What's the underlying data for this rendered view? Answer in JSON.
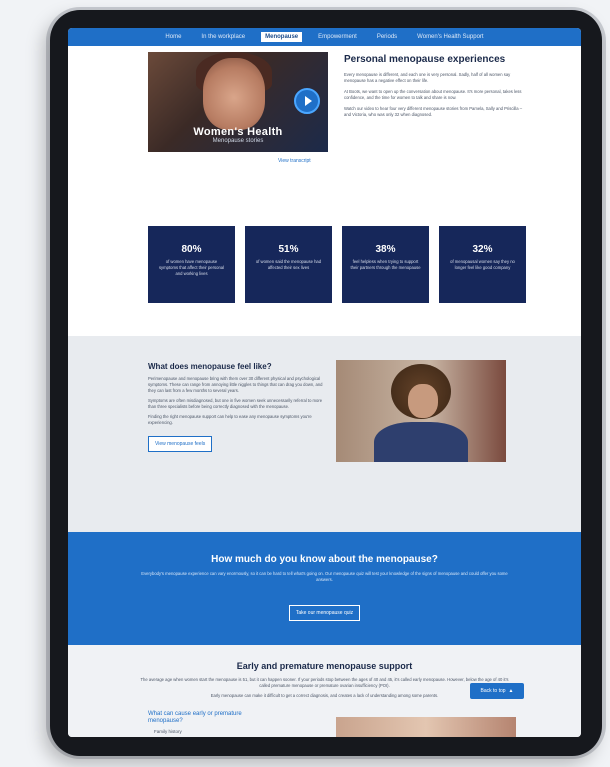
{
  "nav": {
    "items": [
      "Home",
      "In the workplace",
      "Menopause",
      "Empowerment",
      "Periods",
      "Women's Health Support"
    ],
    "active_index": 2
  },
  "story": {
    "video_title": "Women's Health",
    "video_subtitle": "Menopause stories",
    "transcript_link": "View transcript",
    "heading": "Personal menopause experiences",
    "paragraphs": [
      "Every menopause is different, and each one is very personal. Sadly, half of all women say menopause has a negative effect on their life.",
      "At Boots, we want to open up the conversation about menopause. It's more personal, takes less confidence, and the time for women to talk and share is now.",
      "Watch our video to hear four very different menopause stories from Pamela, Sally and Priscilla – and Victoria, who was only 32 when diagnosed."
    ]
  },
  "stats": [
    {
      "num": "80%",
      "desc": "of women have menopause symptoms that affect their personal and working lives"
    },
    {
      "num": "51%",
      "desc": "of women said the menopause had affected their sex lives"
    },
    {
      "num": "38%",
      "desc": "feel helpless when trying to support their partners through the menopause"
    },
    {
      "num": "32%",
      "desc": "of menopausal women say they no longer feel like good company"
    }
  ],
  "feel": {
    "heading": "What does menopause feel like?",
    "paragraphs": [
      "Perimenopause and menopause bring with them over 30 different physical and psychological symptoms. These can range from annoying little niggles to things that can drag you down, and they can last from a few months to several years.",
      "Symptoms are often misdiagnosed, but one in five women seek unnecessarily referral to more than three specialists before being correctly diagnosed with the menopause.",
      "Finding the right menopause support can help to ease any menopause symptoms you're experiencing."
    ],
    "button": "View menopause feels"
  },
  "quiz": {
    "heading": "How much do you know about the menopause?",
    "text": "Everybody's menopause experience can vary enormously, so it can be hard to tell what's going on. Our menopause quiz will test your knowledge of the signs of menopause and could offer you some answers.",
    "button": "Take our menopause quiz"
  },
  "early": {
    "heading": "Early and premature menopause support",
    "p1": "The average age when women start the menopause is 51, but it can happen sooner. If your periods stop between the ages of 40 and 45, it's called early menopause. However, below the age of 40 it's called premature menopause or premature ovarian insufficiency (POI).",
    "p2": "Early menopause can make it difficult to get a correct diagnosis, and creates a lack of understanding among some parents.",
    "sub": "What can cause early or premature menopause?",
    "bullet": "Family history"
  },
  "back_to_top": "Back to top"
}
